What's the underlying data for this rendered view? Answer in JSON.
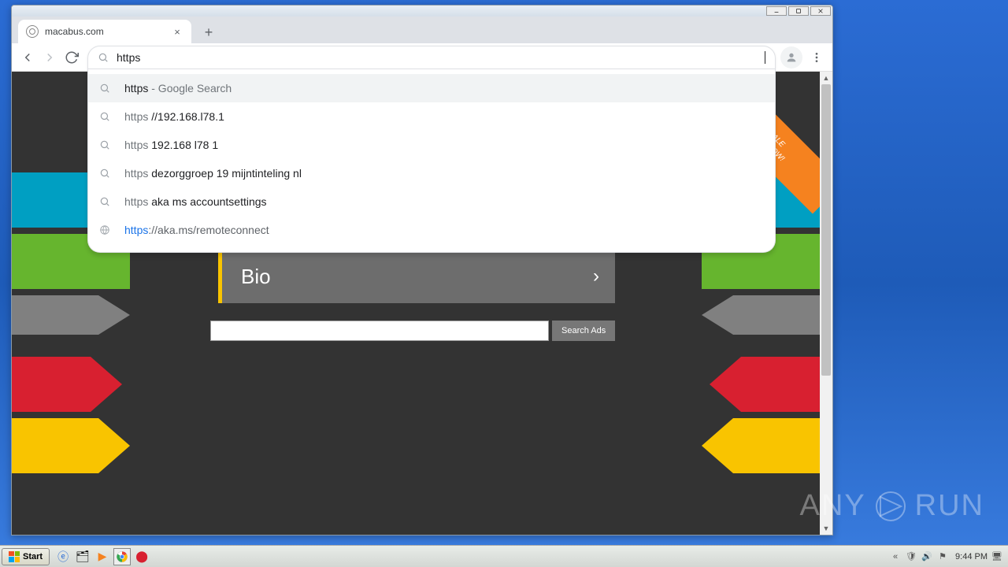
{
  "window": {
    "title": "macabus.com"
  },
  "tab": {
    "title": "macabus.com"
  },
  "omnibox": {
    "value": "https"
  },
  "suggestions": [
    {
      "icon": "search",
      "prefix": "https",
      "suffix": " - Google Search",
      "kind": "search-suffix"
    },
    {
      "icon": "search",
      "prefix": "https ",
      "bold": "//192.168.l78.1",
      "kind": "search"
    },
    {
      "icon": "search",
      "prefix": "https ",
      "bold": "192.168 l78 1",
      "kind": "search"
    },
    {
      "icon": "search",
      "prefix": "https ",
      "bold": "dezorggroep 19 mijntinteling nl",
      "kind": "search"
    },
    {
      "icon": "search",
      "prefix": "https ",
      "bold": "aka ms accountsettings",
      "kind": "search"
    },
    {
      "icon": "globe",
      "blue": "https",
      "gray": "://aka.ms/remoteconnect",
      "kind": "url"
    }
  ],
  "page": {
    "bio_label": "Bio",
    "search_button": "Search Ads",
    "ribbon_line1": "SALE",
    "ribbon_line2": "BUY NOW!"
  },
  "taskbar": {
    "start": "Start",
    "time": "9:44 PM"
  },
  "watermark": {
    "left": "ANY",
    "right": "RUN"
  },
  "colors": {
    "teal": "#009fc2",
    "green": "#66b52e",
    "gray": "#808080",
    "red": "#d82030",
    "yellow": "#f9c400",
    "orange": "#f5821f",
    "dark": "#333333"
  }
}
